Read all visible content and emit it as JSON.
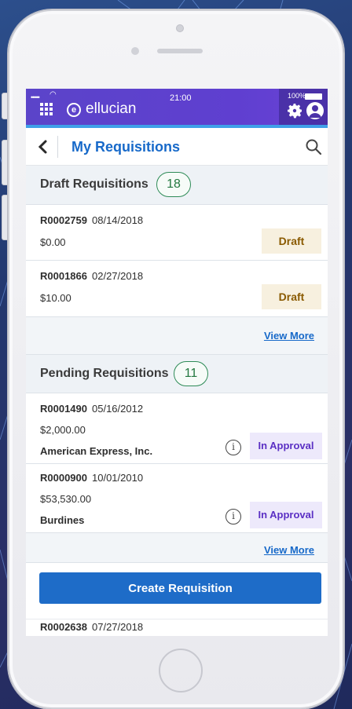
{
  "status_bar": {
    "signal": "•••••",
    "time": "21:00",
    "battery": "100%",
    "brand": "ellucian"
  },
  "header": {
    "title": "My Requisitions"
  },
  "draft_section": {
    "title": "Draft Requisitions",
    "count": "18",
    "items": [
      {
        "id": "R0002759",
        "date": "08/14/2018",
        "amount": "$0.00",
        "status": "Draft"
      },
      {
        "id": "R0001866",
        "date": "02/27/2018",
        "amount": "$10.00",
        "status": "Draft"
      }
    ],
    "view_more": "View More"
  },
  "pending_section": {
    "title": "Pending Requisitions",
    "count": "11",
    "items": [
      {
        "id": "R0001490",
        "date": "05/16/2012",
        "amount": "$2,000.00",
        "vendor": "American Express, Inc.",
        "status": "In Approval"
      },
      {
        "id": "R0000900",
        "date": "10/01/2010",
        "amount": "$53,530.00",
        "vendor": "Burdines",
        "status": "In Approval"
      }
    ],
    "view_more": "View More"
  },
  "action": {
    "create_label": "Create Requisition"
  },
  "peek_item": {
    "id": "R0002638",
    "date": "07/27/2018"
  },
  "icons": {
    "menu": "grid-menu-icon",
    "logo": "ellucian-logo-icon",
    "settings": "gear-icon",
    "profile": "avatar-icon",
    "back": "chevron-left-icon",
    "search": "search-icon",
    "info": "info-icon"
  },
  "colors": {
    "app_bar": "#5b44c9",
    "title_blue": "#1769c9",
    "button_blue": "#1e6cc8",
    "badge_green": "#2e8b57",
    "draft_tag_bg": "#f7f0df",
    "draft_tag_text": "#8a5a00",
    "approval_tag_bg": "#ede9fb",
    "approval_tag_text": "#5a2fc4"
  }
}
